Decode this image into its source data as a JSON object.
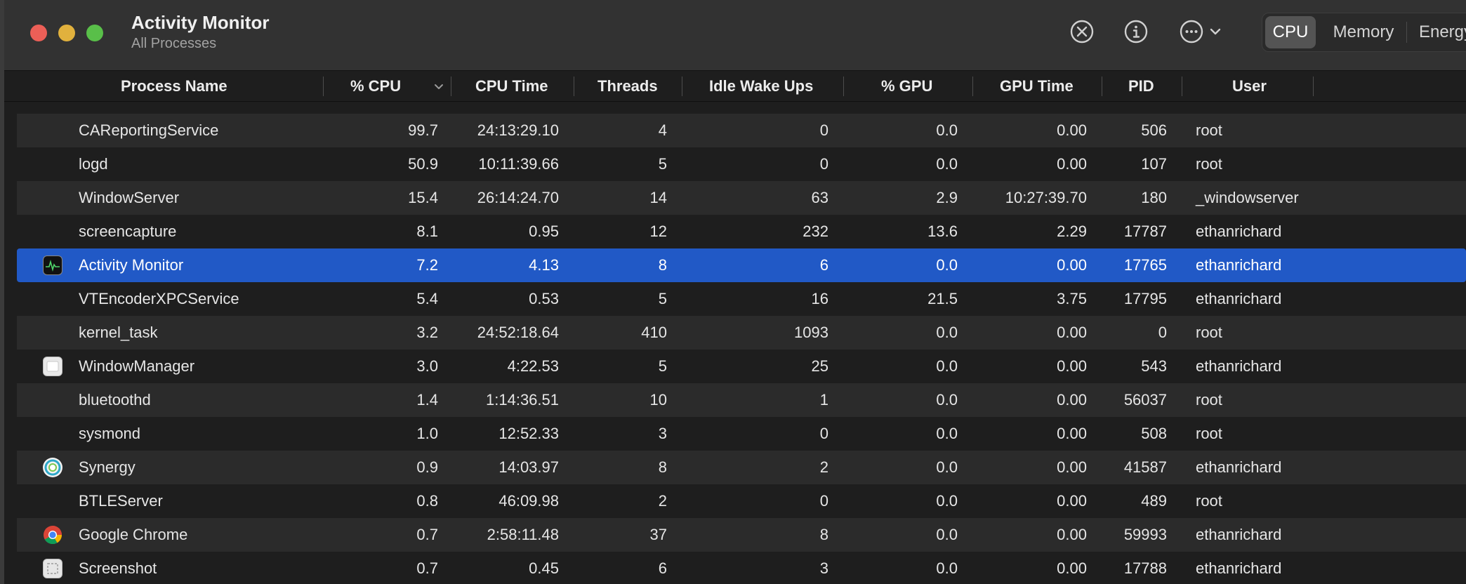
{
  "window": {
    "title": "Activity Monitor",
    "subtitle": "All Processes"
  },
  "toolbar": {
    "stop_icon": "xmark-circle-icon",
    "info_icon": "info-circle-icon",
    "more_icon": "ellipsis-circle-icon",
    "tabs": [
      "CPU",
      "Memory",
      "Energy"
    ],
    "active_tab": "CPU"
  },
  "columns": [
    "Process Name",
    "% CPU",
    "CPU Time",
    "Threads",
    "Idle Wake Ups",
    "% GPU",
    "GPU Time",
    "PID",
    "User"
  ],
  "sort_column": "% CPU",
  "sort_direction": "descending",
  "processes": [
    {
      "name": "CAReportingService",
      "cpu": "99.7",
      "cpu_time": "24:13:29.10",
      "threads": "4",
      "idle_wake_ups": "0",
      "gpu": "0.0",
      "gpu_time": "0.00",
      "pid": "506",
      "user": "root",
      "icon": ""
    },
    {
      "name": "logd",
      "cpu": "50.9",
      "cpu_time": "10:11:39.66",
      "threads": "5",
      "idle_wake_ups": "0",
      "gpu": "0.0",
      "gpu_time": "0.00",
      "pid": "107",
      "user": "root",
      "icon": ""
    },
    {
      "name": "WindowServer",
      "cpu": "15.4",
      "cpu_time": "26:14:24.70",
      "threads": "14",
      "idle_wake_ups": "63",
      "gpu": "2.9",
      "gpu_time": "10:27:39.70",
      "pid": "180",
      "user": "_windowserver",
      "icon": ""
    },
    {
      "name": "screencapture",
      "cpu": "8.1",
      "cpu_time": "0.95",
      "threads": "12",
      "idle_wake_ups": "232",
      "gpu": "13.6",
      "gpu_time": "2.29",
      "pid": "17787",
      "user": "ethanrichard",
      "icon": ""
    },
    {
      "name": "Activity Monitor",
      "cpu": "7.2",
      "cpu_time": "4.13",
      "threads": "8",
      "idle_wake_ups": "6",
      "gpu": "0.0",
      "gpu_time": "0.00",
      "pid": "17765",
      "user": "ethanrichard",
      "icon": "activity-monitor-icon",
      "selected": true
    },
    {
      "name": "VTEncoderXPCService",
      "cpu": "5.4",
      "cpu_time": "0.53",
      "threads": "5",
      "idle_wake_ups": "16",
      "gpu": "21.5",
      "gpu_time": "3.75",
      "pid": "17795",
      "user": "ethanrichard",
      "icon": ""
    },
    {
      "name": "kernel_task",
      "cpu": "3.2",
      "cpu_time": "24:52:18.64",
      "threads": "410",
      "idle_wake_ups": "1093",
      "gpu": "0.0",
      "gpu_time": "0.00",
      "pid": "0",
      "user": "root",
      "icon": ""
    },
    {
      "name": "WindowManager",
      "cpu": "3.0",
      "cpu_time": "4:22.53",
      "threads": "5",
      "idle_wake_ups": "25",
      "gpu": "0.0",
      "gpu_time": "0.00",
      "pid": "543",
      "user": "ethanrichard",
      "icon": "window-manager-icon"
    },
    {
      "name": "bluetoothd",
      "cpu": "1.4",
      "cpu_time": "1:14:36.51",
      "threads": "10",
      "idle_wake_ups": "1",
      "gpu": "0.0",
      "gpu_time": "0.00",
      "pid": "56037",
      "user": "root",
      "icon": ""
    },
    {
      "name": "sysmond",
      "cpu": "1.0",
      "cpu_time": "12:52.33",
      "threads": "3",
      "idle_wake_ups": "0",
      "gpu": "0.0",
      "gpu_time": "0.00",
      "pid": "508",
      "user": "root",
      "icon": ""
    },
    {
      "name": "Synergy",
      "cpu": "0.9",
      "cpu_time": "14:03.97",
      "threads": "8",
      "idle_wake_ups": "2",
      "gpu": "0.0",
      "gpu_time": "0.00",
      "pid": "41587",
      "user": "ethanrichard",
      "icon": "synergy-icon"
    },
    {
      "name": "BTLEServer",
      "cpu": "0.8",
      "cpu_time": "46:09.98",
      "threads": "2",
      "idle_wake_ups": "0",
      "gpu": "0.0",
      "gpu_time": "0.00",
      "pid": "489",
      "user": "root",
      "icon": ""
    },
    {
      "name": "Google Chrome",
      "cpu": "0.7",
      "cpu_time": "2:58:11.48",
      "threads": "37",
      "idle_wake_ups": "8",
      "gpu": "0.0",
      "gpu_time": "0.00",
      "pid": "59993",
      "user": "ethanrichard",
      "icon": "google-chrome-icon"
    },
    {
      "name": "Screenshot",
      "cpu": "0.7",
      "cpu_time": "0.45",
      "threads": "6",
      "idle_wake_ups": "3",
      "gpu": "0.0",
      "gpu_time": "0.00",
      "pid": "17788",
      "user": "ethanrichard",
      "icon": "screenshot-icon"
    }
  ],
  "colors": {
    "selection": "#2159c6",
    "close": "#ec5f57",
    "minimize": "#e1b13d",
    "maximize": "#59bf49"
  }
}
